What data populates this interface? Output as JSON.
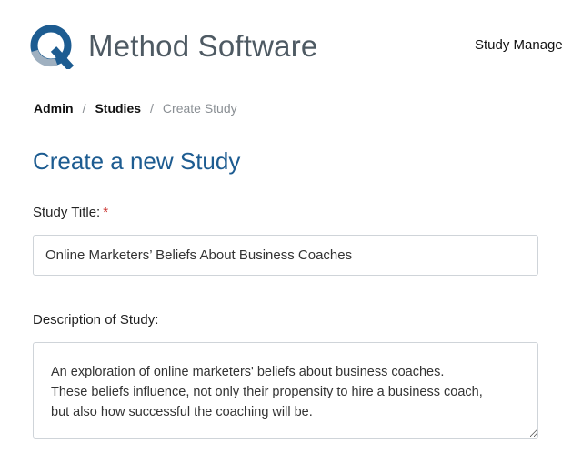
{
  "header": {
    "app_name": "Method Software",
    "logo_icon": "q-logo-icon",
    "nav_item": "Study Manage"
  },
  "breadcrumb": {
    "items": [
      "Admin",
      "Studies"
    ],
    "current": "Create Study",
    "separator": "/"
  },
  "page": {
    "title": "Create a new Study"
  },
  "form": {
    "study_title_label": "Study Title:",
    "required_marker": "*",
    "study_title_value": "Online Marketers’ Beliefs About Business Coaches",
    "description_label": "Description of Study:",
    "description_value": "An exploration of online marketers' beliefs about business coaches.\nThese beliefs influence, not only their propensity to hire a business coach,\nbut also how successful the coaching will be."
  },
  "colors": {
    "brand_blue": "#1d5c91",
    "logo_gray": "#9fb0c0",
    "required_red": "#c9302c"
  }
}
